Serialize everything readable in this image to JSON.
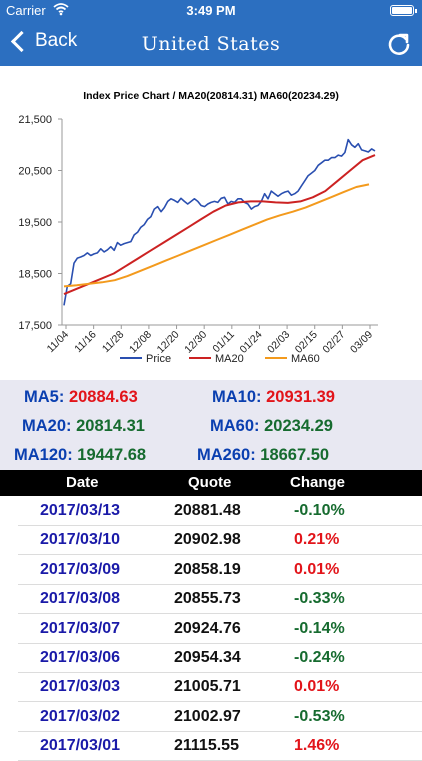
{
  "status_bar": {
    "carrier": "Carrier",
    "time": "3:49 PM"
  },
  "nav": {
    "back_label": "Back",
    "title": "United States"
  },
  "chart_data": {
    "type": "line",
    "title": "Index Price Chart / MA20(20814.31) MA60(20234.29)",
    "x_tick_labels": [
      "11/04",
      "11/16",
      "11/28",
      "12/08",
      "12/20",
      "12/30",
      "01/11",
      "01/24",
      "02/03",
      "02/15",
      "02/27",
      "03/09"
    ],
    "y_tick_labels": [
      "21,500",
      "20,500",
      "19,500",
      "18,500",
      "17,500"
    ],
    "ylim": [
      17500,
      21500
    ],
    "grid": false,
    "legend_position": "bottom",
    "series": [
      {
        "name": "Price",
        "color": "#2a4fb0",
        "values": [
          17880,
          18250,
          18300,
          18700,
          18800,
          18820,
          18850,
          18900,
          18850,
          18880,
          18900,
          18980,
          18920,
          18960,
          19020,
          18950,
          19100,
          19050,
          19080,
          19100,
          19120,
          19250,
          19300,
          19400,
          19450,
          19550,
          19600,
          19750,
          19800,
          19700,
          19780,
          19900,
          19950,
          19920,
          19880,
          19960,
          19900,
          19850,
          19900,
          19950,
          19900,
          19820,
          19800,
          19850,
          19880,
          19900,
          19880,
          19960,
          19980,
          19850,
          19900,
          19880,
          19950,
          19950,
          19880,
          19850,
          19750,
          19800,
          19820,
          19900,
          20050,
          19950,
          20100,
          20050,
          20000,
          20050,
          20080,
          20100,
          20020,
          20050,
          20100,
          20200,
          20300,
          20400,
          20450,
          20500,
          20600,
          20650,
          20700,
          20700,
          20750,
          20750,
          20800,
          20780,
          20850,
          21100,
          21000,
          20950,
          21020,
          20900,
          20880,
          20860,
          20920,
          20880
        ]
      },
      {
        "name": "MA20",
        "color": "#cc2222",
        "values": [
          18100,
          18200,
          18300,
          18400,
          18500,
          18650,
          18800,
          18950,
          19100,
          19250,
          19400,
          19550,
          19700,
          19820,
          19880,
          19900,
          19900,
          19880,
          19870,
          19900,
          19980,
          20100,
          20300,
          20500,
          20700,
          20800
        ]
      },
      {
        "name": "MA60",
        "color": "#f39a1d",
        "values": [
          18250,
          18270,
          18300,
          18330,
          18370,
          18450,
          18550,
          18650,
          18750,
          18850,
          18950,
          19050,
          19150,
          19250,
          19350,
          19450,
          19550,
          19630,
          19700,
          19780,
          19880,
          19980,
          20080,
          20180,
          20230
        ]
      }
    ]
  },
  "stats": [
    {
      "label": "MA5:",
      "value": "20884.63",
      "color": "red"
    },
    {
      "label": "MA10:",
      "value": "20931.39",
      "color": "red"
    },
    {
      "label": "MA20:",
      "value": "20814.31",
      "color": "green"
    },
    {
      "label": "MA60:",
      "value": "20234.29",
      "color": "green"
    },
    {
      "label": "MA120:",
      "value": "19447.68",
      "color": "green"
    },
    {
      "label": "MA260:",
      "value": "18667.50",
      "color": "green"
    }
  ],
  "table": {
    "headers": [
      "Date",
      "Quote",
      "Change"
    ],
    "rows": [
      {
        "date": "2017/03/13",
        "quote": "20881.48",
        "change": "-0.10%",
        "color": "green"
      },
      {
        "date": "2017/03/10",
        "quote": "20902.98",
        "change": "0.21%",
        "color": "red"
      },
      {
        "date": "2017/03/09",
        "quote": "20858.19",
        "change": "0.01%",
        "color": "red"
      },
      {
        "date": "2017/03/08",
        "quote": "20855.73",
        "change": "-0.33%",
        "color": "green"
      },
      {
        "date": "2017/03/07",
        "quote": "20924.76",
        "change": "-0.14%",
        "color": "green"
      },
      {
        "date": "2017/03/06",
        "quote": "20954.34",
        "change": "-0.24%",
        "color": "green"
      },
      {
        "date": "2017/03/03",
        "quote": "21005.71",
        "change": "0.01%",
        "color": "red"
      },
      {
        "date": "2017/03/02",
        "quote": "21002.97",
        "change": "-0.53%",
        "color": "green"
      },
      {
        "date": "2017/03/01",
        "quote": "21115.55",
        "change": "1.46%",
        "color": "red"
      }
    ]
  },
  "icons": {
    "back": "chevron-left-icon",
    "refresh": "refresh-icon",
    "wifi": "wifi-icon",
    "battery": "battery-icon"
  },
  "colors": {
    "nav_bar": "#2c6fc0",
    "stats_background": "#e8e8f2",
    "label_blue": "#0a3fb0",
    "up_red": "#e2141a",
    "down_green": "#166b2f",
    "date_blue": "#1a1aa8"
  }
}
